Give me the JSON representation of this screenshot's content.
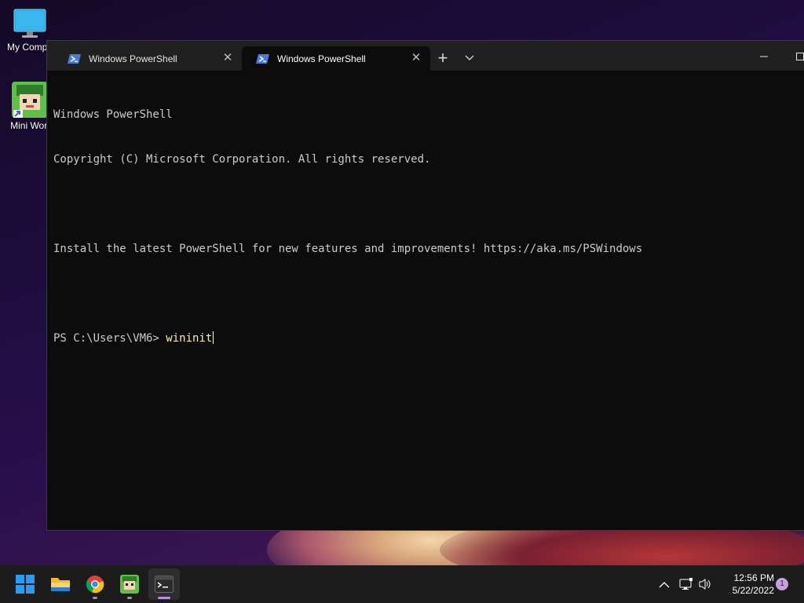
{
  "desktop": {
    "icons": [
      {
        "label": "My Compu",
        "icon": "monitor-icon"
      },
      {
        "label": "Mini Worl",
        "icon": "mini-world-icon"
      }
    ]
  },
  "terminal": {
    "tabs": [
      {
        "title": "Windows PowerShell",
        "active": false
      },
      {
        "title": "Windows PowerShell",
        "active": true
      }
    ],
    "new_tab_label": "+",
    "lines": [
      "Windows PowerShell",
      "Copyright (C) Microsoft Corporation. All rights reserved.",
      "",
      "Install the latest PowerShell for new features and improvements! https://aka.ms/PSWindows",
      ""
    ],
    "prompt": "PS C:\\Users\\VM6> ",
    "command": "wininit",
    "colors": {
      "background": "#0c0c0c",
      "text": "#cccccc",
      "command": "#f9f1a5",
      "tabbar": "#202020"
    }
  },
  "taskbar": {
    "apps": [
      {
        "name": "start-icon"
      },
      {
        "name": "file-explorer-icon"
      },
      {
        "name": "chrome-icon"
      },
      {
        "name": "mini-world-icon"
      },
      {
        "name": "terminal-icon",
        "active": true
      }
    ],
    "clock": {
      "time": "12:56 PM",
      "date": "5/22/2022"
    },
    "notification_count": "1",
    "accent": "#c08ee0"
  }
}
